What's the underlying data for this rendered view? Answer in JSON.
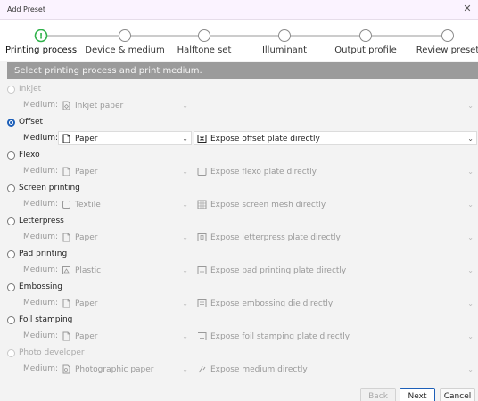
{
  "window": {
    "title": "Add Preset",
    "close_glyph": "✕"
  },
  "steps": [
    {
      "label": "Printing process",
      "state": "current"
    },
    {
      "label": "Device & medium",
      "state": "pending"
    },
    {
      "label": "Halftone set",
      "state": "pending"
    },
    {
      "label": "Illuminant",
      "state": "pending"
    },
    {
      "label": "Output profile",
      "state": "pending"
    },
    {
      "label": "Review preset",
      "state": "pending"
    }
  ],
  "step_current_glyph": "!",
  "banner": "Select printing process and print medium.",
  "medium_label": "Medium:",
  "processes": [
    {
      "name": "Inkjet",
      "selected": false,
      "enabled": false,
      "medium": "Inkjet paper",
      "medium_icon": "inkjet-paper-icon",
      "exposure": "",
      "exposure_icon": ""
    },
    {
      "name": "Offset",
      "selected": true,
      "enabled": true,
      "medium": "Paper",
      "medium_icon": "paper-icon",
      "exposure": "Expose offset plate directly",
      "exposure_icon": "offset-plate-icon"
    },
    {
      "name": "Flexo",
      "selected": false,
      "enabled": true,
      "medium": "Paper",
      "medium_icon": "paper-icon",
      "exposure": "Expose flexo plate directly",
      "exposure_icon": "flexo-plate-icon"
    },
    {
      "name": "Screen printing",
      "selected": false,
      "enabled": true,
      "medium": "Textile",
      "medium_icon": "textile-icon",
      "exposure": "Expose screen mesh directly",
      "exposure_icon": "screen-mesh-icon"
    },
    {
      "name": "Letterpress",
      "selected": false,
      "enabled": true,
      "medium": "Paper",
      "medium_icon": "paper-icon",
      "exposure": "Expose letterpress plate directly",
      "exposure_icon": "letterpress-plate-icon"
    },
    {
      "name": "Pad printing",
      "selected": false,
      "enabled": true,
      "medium": "Plastic",
      "medium_icon": "plastic-icon",
      "exposure": "Expose pad printing plate directly",
      "exposure_icon": "pad-plate-icon"
    },
    {
      "name": "Embossing",
      "selected": false,
      "enabled": true,
      "medium": "Paper",
      "medium_icon": "paper-icon",
      "exposure": "Expose embossing die directly",
      "exposure_icon": "embossing-die-icon"
    },
    {
      "name": "Foil stamping",
      "selected": false,
      "enabled": true,
      "medium": "Paper",
      "medium_icon": "paper-icon",
      "exposure": "Expose foil stamping plate directly",
      "exposure_icon": "foil-plate-icon"
    },
    {
      "name": "Photo developer",
      "selected": false,
      "enabled": false,
      "medium": "Photographic paper",
      "medium_icon": "photo-paper-icon",
      "exposure": "Expose medium directly",
      "exposure_icon": "expose-medium-icon"
    }
  ],
  "buttons": {
    "back": "Back",
    "next": "Next",
    "cancel": "Cancel"
  },
  "colors": {
    "accent": "#1d5fb8",
    "current_step": "#2fb14a",
    "banner_bg": "#9b9b9b"
  }
}
